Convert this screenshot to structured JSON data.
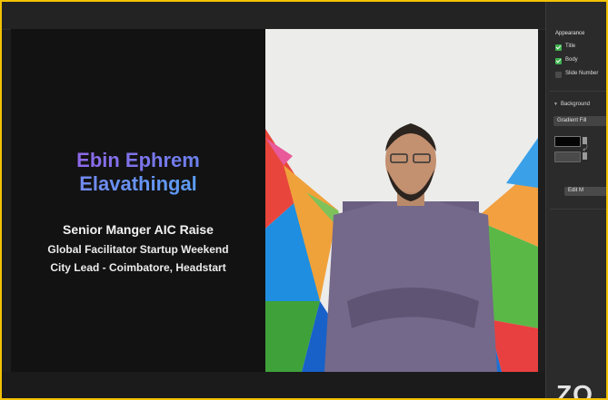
{
  "slide": {
    "name_line1": "Ebin Ephrem",
    "name_line2": "Elavathingal",
    "role": "Senior Manger AIC Raise",
    "subtitle1": "Global Facilitator Startup Weekend",
    "subtitle2": "City Lead - Coimbatore, Headstart"
  },
  "inspector": {
    "appearance_title": "Appearance",
    "checkboxes": [
      {
        "label": "Title",
        "checked": true
      },
      {
        "label": "Body",
        "checked": true
      },
      {
        "label": "Slide Number",
        "checked": false
      }
    ],
    "background_title": "Background",
    "fill_type": "Gradient Fill",
    "color1": "#050505",
    "color2": "#4a4a4a",
    "edit_button_label": "Edit M"
  },
  "watermark": "ZO",
  "colors": {
    "border": "#f2c200",
    "accent_purple": "#a05ae6",
    "accent_blue": "#4fa8f5",
    "checkbox_green": "#3fb34f"
  }
}
